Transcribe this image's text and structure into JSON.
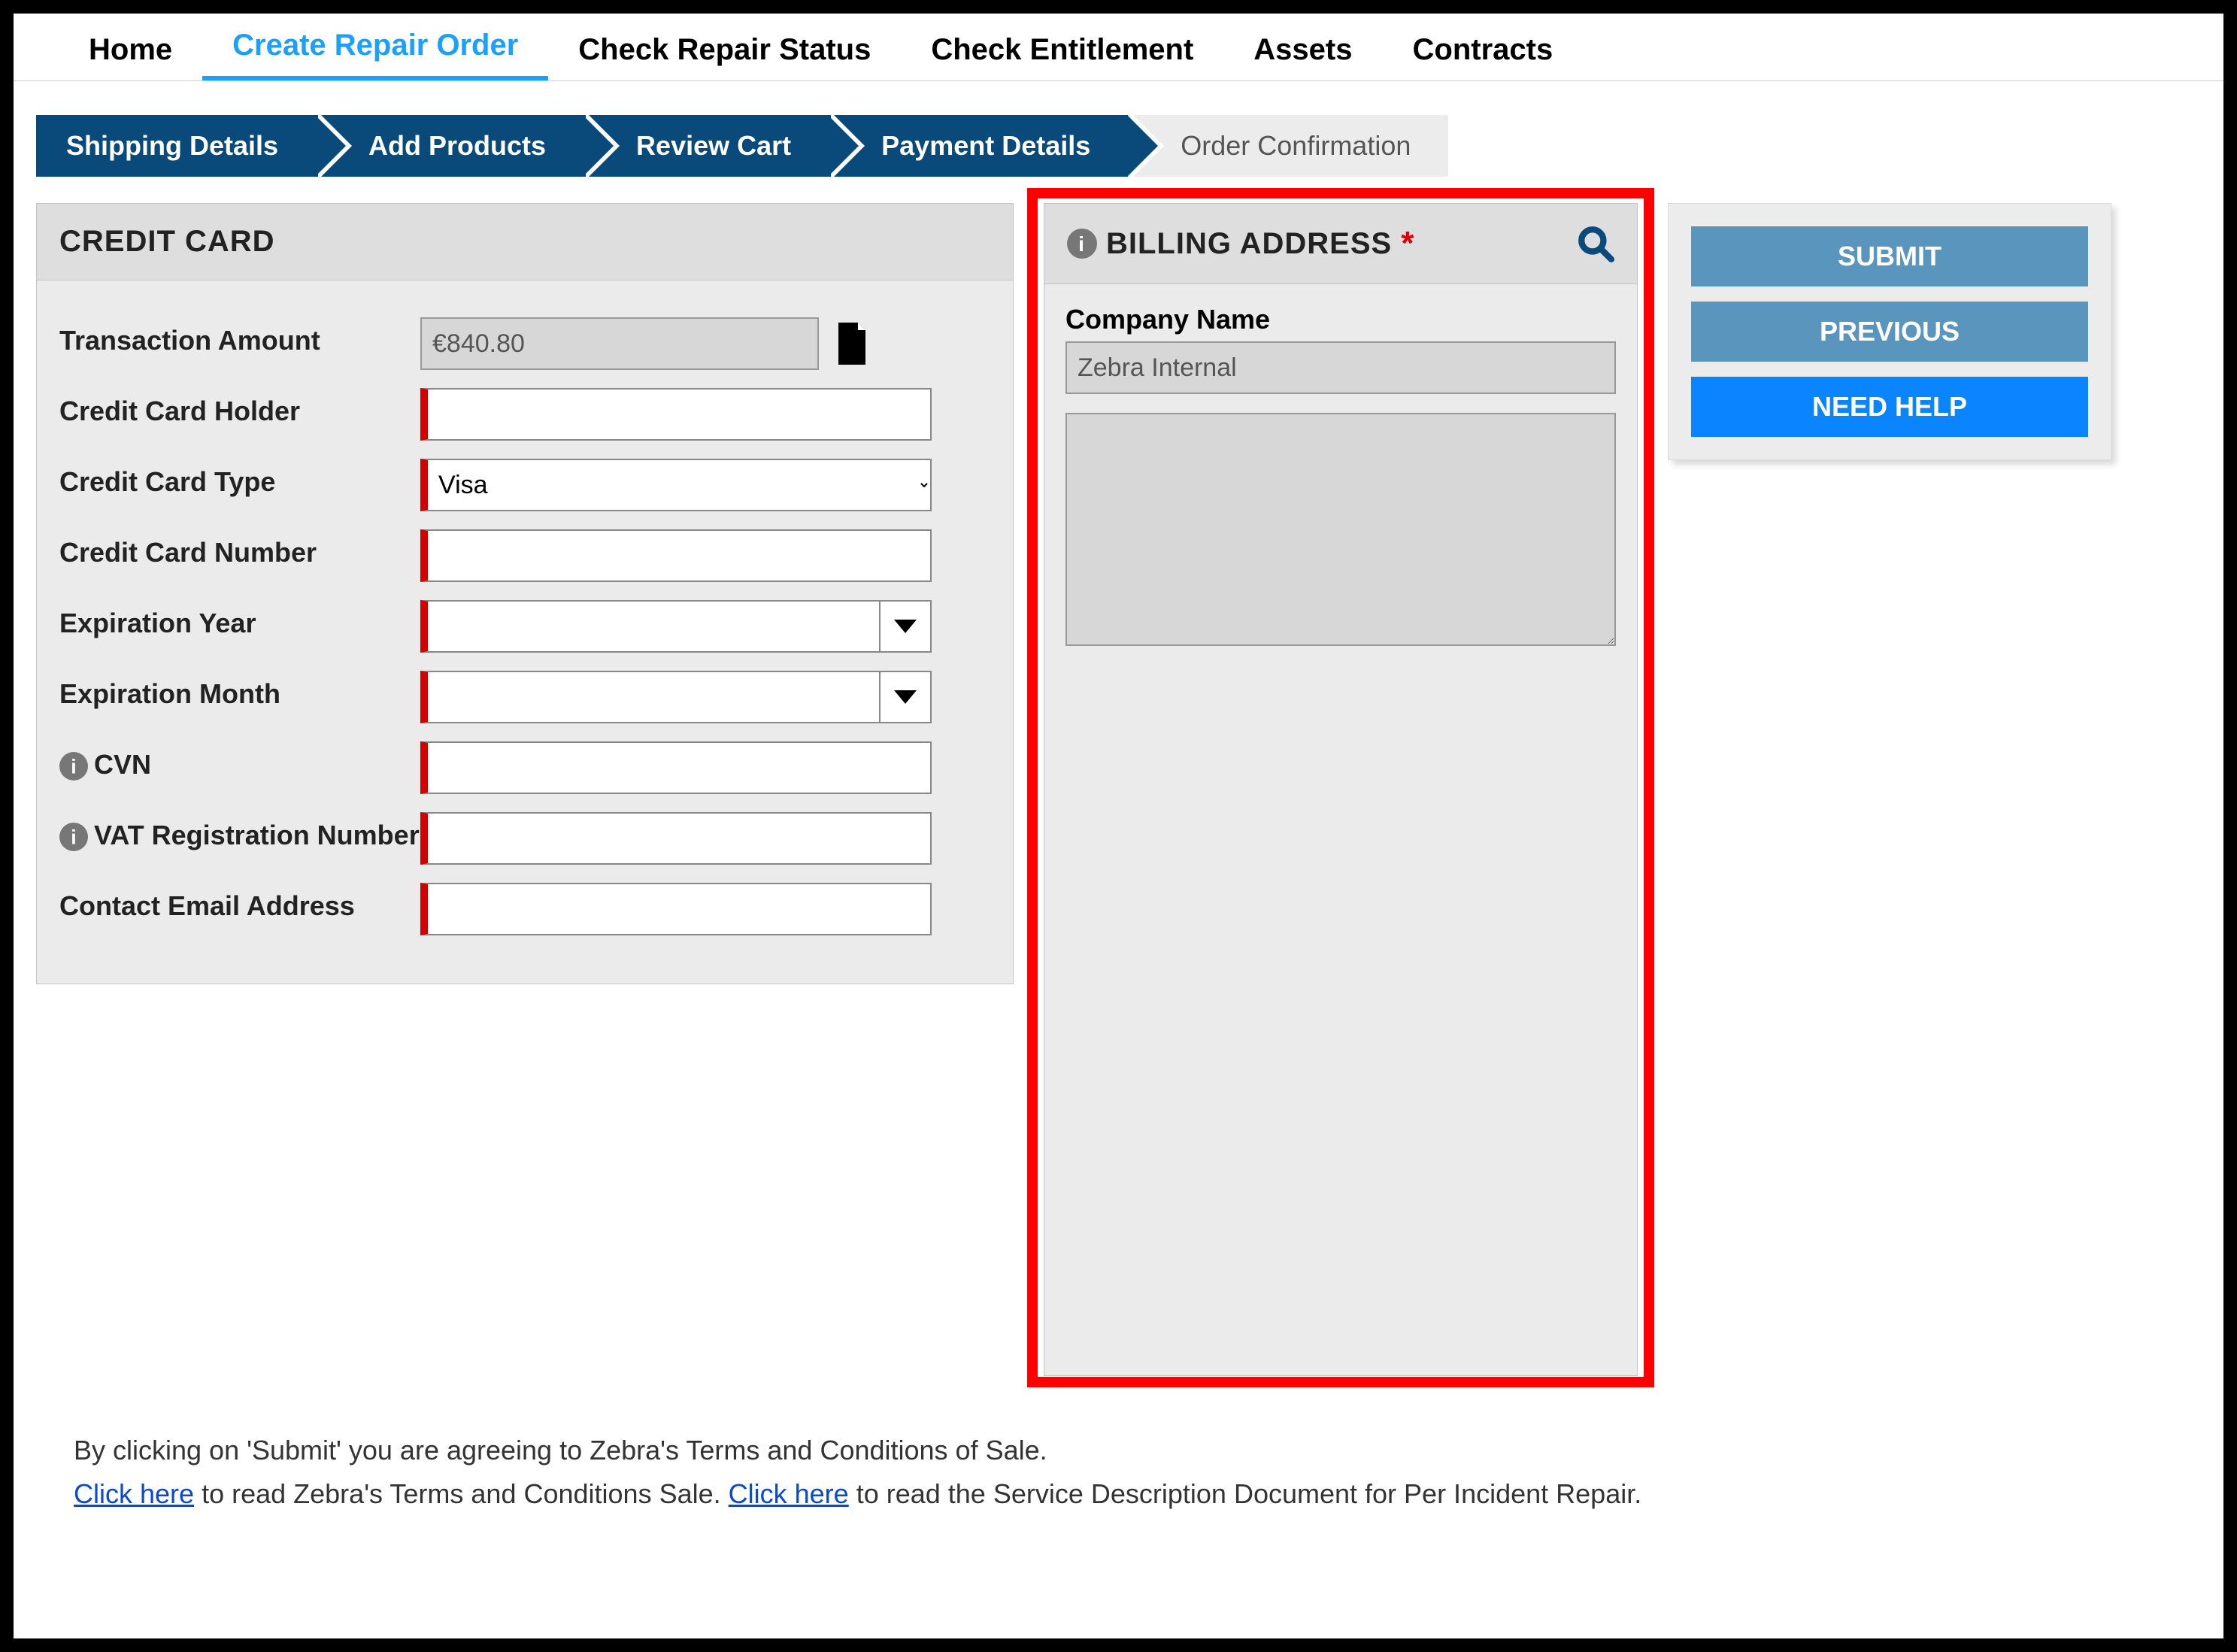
{
  "topnav": {
    "items": [
      {
        "label": "Home"
      },
      {
        "label": "Create Repair Order"
      },
      {
        "label": "Check Repair Status"
      },
      {
        "label": "Check Entitlement"
      },
      {
        "label": "Assets"
      },
      {
        "label": "Contracts"
      }
    ],
    "active_index": 1
  },
  "progress": {
    "steps": [
      {
        "label": "Shipping Details"
      },
      {
        "label": "Add Products"
      },
      {
        "label": "Review Cart"
      },
      {
        "label": "Payment Details"
      },
      {
        "label": "Order Confirmation"
      }
    ],
    "active_through": 3
  },
  "credit_card": {
    "header": "CREDIT CARD",
    "transaction_amount_label": "Transaction Amount",
    "transaction_amount_value": "€840.80",
    "holder_label": "Credit Card Holder",
    "holder_value": "",
    "type_label": "Credit Card Type",
    "type_value": "Visa",
    "number_label": "Credit Card Number",
    "number_value": "",
    "exp_year_label": "Expiration Year",
    "exp_year_value": "",
    "exp_month_label": "Expiration Month",
    "exp_month_value": "",
    "cvn_label": "CVN",
    "cvn_value": "",
    "vat_label": "VAT Registration Number",
    "vat_value": "",
    "email_label": "Contact Email Address",
    "email_value": ""
  },
  "billing": {
    "header": "BILLING ADDRESS",
    "company_label": "Company Name",
    "company_value": "Zebra Internal",
    "address_value": ""
  },
  "buttons": {
    "submit": "SUBMIT",
    "previous": "PREVIOUS",
    "need_help": "NEED HELP"
  },
  "footer": {
    "line1": "By clicking on 'Submit' you are agreeing to Zebra's Terms and Conditions of Sale.",
    "link1": "Click here",
    "mid1": " to read Zebra's Terms and Conditions Sale. ",
    "link2": "Click here",
    "mid2": " to read the Service Description Document for Per Incident Repair."
  }
}
